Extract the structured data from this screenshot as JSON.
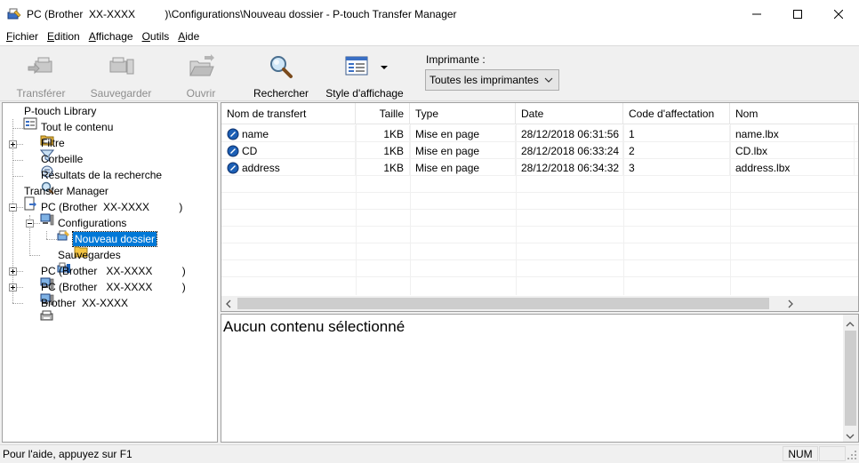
{
  "window": {
    "title": "PC (Brother  XX-XXXX          )\\Configurations\\Nouveau dossier - P-touch Transfer Manager",
    "minimize_glyph": "—",
    "maximize_glyph": "☐",
    "close_glyph": "✕"
  },
  "menu": [
    {
      "label": "Fichier",
      "mnemonic": "F"
    },
    {
      "label": "Edition",
      "mnemonic": "E"
    },
    {
      "label": "Affichage",
      "mnemonic": "A"
    },
    {
      "label": "Outils",
      "mnemonic": "O"
    },
    {
      "label": "Aide",
      "mnemonic": "A"
    }
  ],
  "toolbar": {
    "transfer_label": "Transférer",
    "backup_label": "Sauvegarder",
    "open_label": "Ouvrir",
    "search_label": "Rechercher",
    "view_style_label": "Style d'affichage",
    "printer_label": "Imprimante :",
    "printer_selected": "Toutes les imprimantes"
  },
  "tree": {
    "library": "P-touch Library",
    "all_content": "Tout le contenu",
    "filter": "Filtre",
    "trash": "Corbeille",
    "search_results": "Résultats de la recherche",
    "transfer_manager": "Transfer Manager",
    "pc1": "PC (Brother  XX-XXXX          )",
    "configurations": "Configurations",
    "new_folder": "Nouveau dossier",
    "backups": "Sauvegardes",
    "pc2": "PC (Brother   XX-XXXX          )",
    "pc3": "PC (Brother   XX-XXXX          )",
    "brother": "Brother  XX-XXXX"
  },
  "list": {
    "columns": [
      "Nom de transfert",
      "Taille",
      "Type",
      "Date",
      "Code d'affectation",
      "Nom"
    ],
    "rows": [
      {
        "name": "name",
        "size": "1KB",
        "type": "Mise en page",
        "date": "28/12/2018 06:31:56",
        "code": "1",
        "file": "name.lbx"
      },
      {
        "name": "CD",
        "size": "1KB",
        "type": "Mise en page",
        "date": "28/12/2018 06:33:24",
        "code": "2",
        "file": "CD.lbx"
      },
      {
        "name": "address",
        "size": "1KB",
        "type": "Mise en page",
        "date": "28/12/2018 06:34:32",
        "code": "3",
        "file": "address.lbx"
      }
    ]
  },
  "detail": {
    "text": "Aucun contenu sélectionné"
  },
  "status": {
    "help": "Pour l'aide, appuyez sur F1",
    "num": "NUM"
  },
  "colors": {
    "selection": "#0078d7",
    "folder": "#f5c542",
    "pc_blue": "#1c5fb5"
  }
}
